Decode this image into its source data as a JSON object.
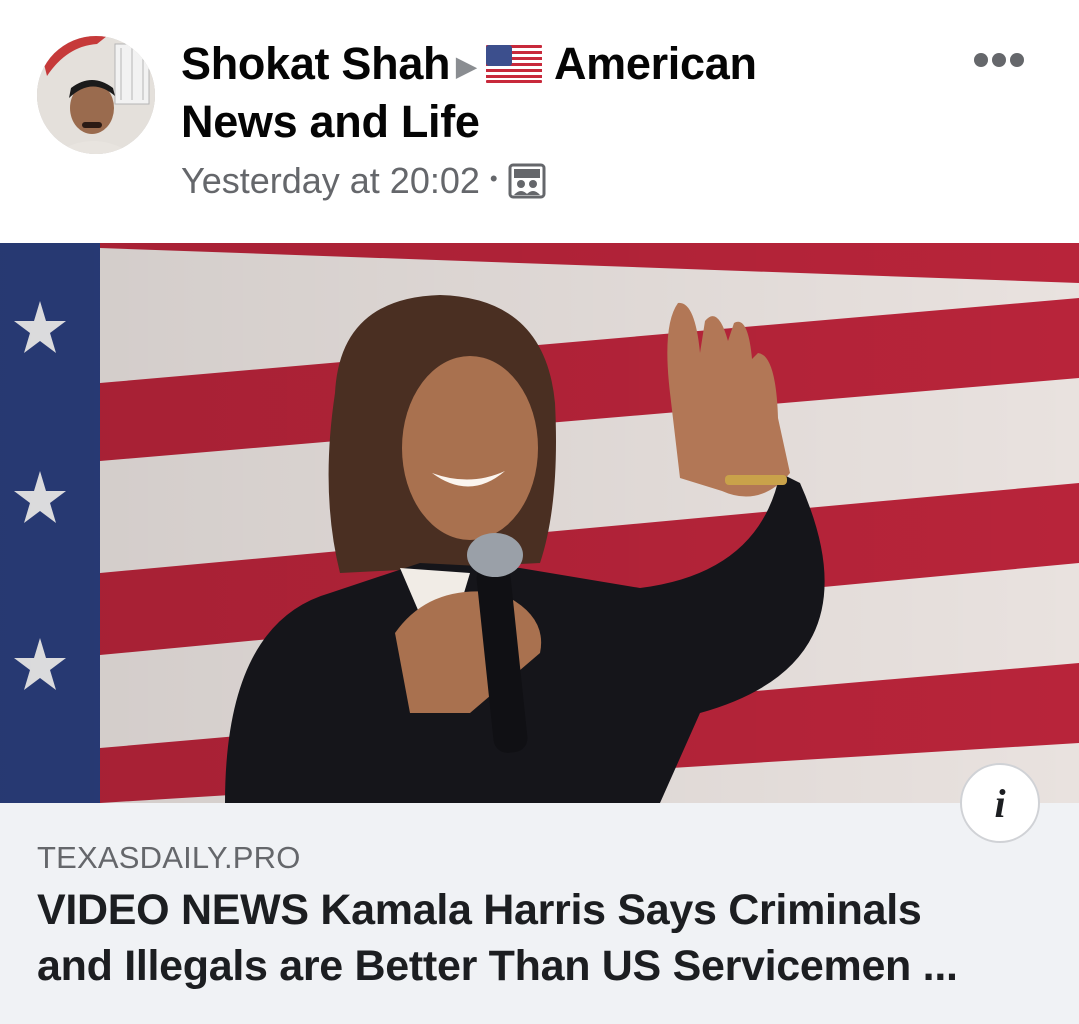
{
  "post": {
    "author": "Shokat Shah",
    "separator_icon": "triangle-right-icon",
    "group_flag": "us-flag-emoji",
    "group_name_line1": "American",
    "group_name_line2": "News and Life",
    "timestamp": "Yesterday at 20:02",
    "dot": "•",
    "audience_icon": "group-photo-icon",
    "more_icon": "ellipsis-icon"
  },
  "link": {
    "domain": "TEXASDAILY.PRO",
    "headline_line1": "VIDEO NEWS Kamala Harris Says Criminals",
    "headline_line2": "and Illegals are Better Than US Servicemen ...",
    "info_label": "i"
  },
  "colors": {
    "flag_red": "#b8243a",
    "flag_blue": "#2b3f7e",
    "link_bg": "#f0f2f5",
    "meta_gray": "#65676b"
  }
}
